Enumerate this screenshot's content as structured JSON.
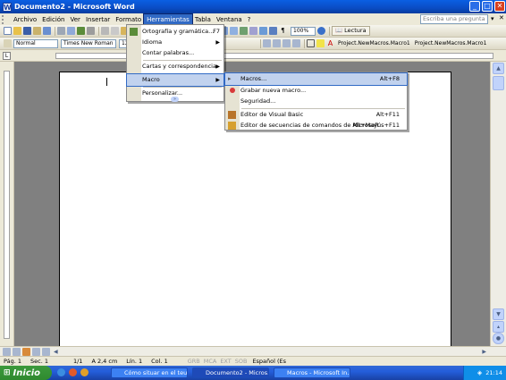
{
  "window": {
    "title": "Documento2 - Microsoft Word",
    "app_icon": "word-app-icon"
  },
  "menubar": {
    "items": [
      "Archivo",
      "Edición",
      "Ver",
      "Insertar",
      "Formato",
      "Herramientas",
      "Tabla",
      "Ventana",
      "?"
    ],
    "active_index": 5,
    "help_placeholder": "Escriba una pregunta"
  },
  "toolbar2": {
    "style": "Normal",
    "font": "Times New Roman",
    "size": "12",
    "zoom": "100%",
    "reading_label": "Lectura",
    "macro_buttons": [
      "Project.NewMacros.Macro1",
      "Project.NewMacros.Macro1"
    ]
  },
  "tools_menu": {
    "items": [
      {
        "label": "Ortografía y gramática...",
        "accel": "F7",
        "submenu": false
      },
      {
        "label": "Idioma",
        "accel": "",
        "submenu": true
      },
      {
        "label": "Contar palabras...",
        "accel": "",
        "submenu": false
      },
      {
        "label": "Cartas y correspondencia",
        "accel": "",
        "submenu": true
      },
      {
        "label": "Macro",
        "accel": "",
        "submenu": true
      },
      {
        "label": "Personalizar...",
        "accel": "",
        "submenu": false
      }
    ],
    "highlighted_index": 4
  },
  "macro_menu": {
    "items": [
      {
        "label": "Macros...",
        "accel": "Alt+F8"
      },
      {
        "label": "Grabar nueva macro...",
        "accel": ""
      },
      {
        "label": "Seguridad...",
        "accel": ""
      },
      {
        "label": "Editor de Visual Basic",
        "accel": "Alt+F11"
      },
      {
        "label": "Editor de secuencias de comandos de Microsoft",
        "accel": "Alt+Mayús+F11"
      }
    ],
    "highlighted_index": 0
  },
  "statusbar": {
    "page": "Pág. 1",
    "section": "Sec. 1",
    "pages": "1/1",
    "position": "A 2,4 cm",
    "line": "Lín. 1",
    "column": "Col. 1",
    "modes": [
      "GRB",
      "MCA",
      "EXT",
      "SOB"
    ],
    "language": "Español (Es"
  },
  "taskbar": {
    "start_label": "Inicio",
    "tasks": [
      "Cómo situar en el teu ...",
      "Documento2 - Micros...",
      "Macros - Microsoft In..."
    ],
    "active_task_index": 1,
    "clock": "21:14"
  },
  "colors": {
    "titlebar": "#0a4cc4",
    "menu_highlight": "#316ac5",
    "taskbar": "#245edb",
    "start": "#2f8a2f"
  }
}
